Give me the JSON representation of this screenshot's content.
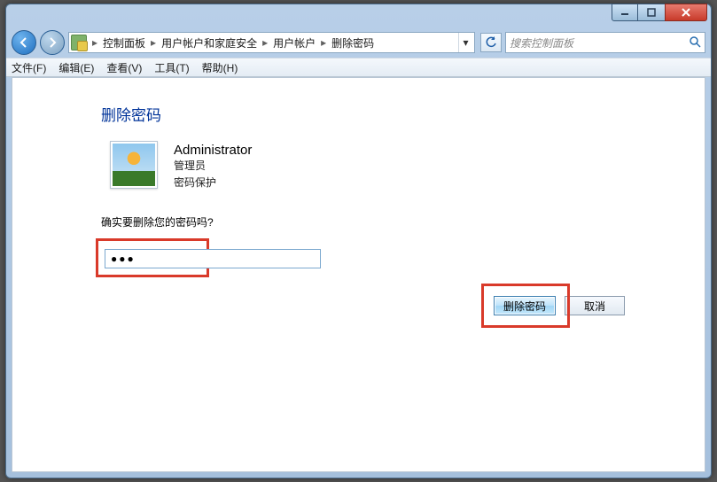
{
  "titlebar": {
    "min_tip": "最小化",
    "max_tip": "最大化",
    "close_tip": "关闭"
  },
  "nav": {
    "back_tip": "后退",
    "forward_tip": "前进",
    "refresh_tip": "刷新",
    "dropdown_tip": "最近位置"
  },
  "breadcrumbs": {
    "seg1": "控制面板",
    "seg2": "用户帐户和家庭安全",
    "seg3": "用户帐户",
    "seg4": "删除密码"
  },
  "search": {
    "placeholder": "搜索控制面板"
  },
  "menu": {
    "file": "文件(F)",
    "edit": "编辑(E)",
    "view": "查看(V)",
    "tools": "工具(T)",
    "help": "帮助(H)"
  },
  "page": {
    "heading": "删除密码",
    "username": "Administrator",
    "role": "管理员",
    "protection": "密码保护",
    "confirm_text": "确实要删除您的密码吗?",
    "password_display": "●●●"
  },
  "buttons": {
    "delete": "删除密码",
    "cancel": "取消"
  }
}
